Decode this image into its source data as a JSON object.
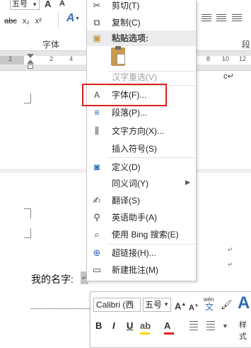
{
  "ribbon": {
    "font_size_value": "五号",
    "grow_font": "A",
    "shrink_font": "A",
    "text_effect": "A",
    "clear_format": "abc",
    "subscript": "x₂",
    "superscript": "x²",
    "group_font_label": "字体",
    "group_paragraph_label": "段"
  },
  "ruler": {
    "ticks": [
      "2",
      "2",
      "4",
      "8",
      "10",
      "12"
    ]
  },
  "context_menu": {
    "items": [
      {
        "label": "剪切(T)",
        "icon": "scissors-icon",
        "enabled": true
      },
      {
        "label": "复制(C)",
        "icon": "copy-icon",
        "enabled": true
      },
      {
        "label": "粘贴选项:",
        "icon": "paste-icon",
        "enabled": true
      },
      {
        "label": "汉字重选(V)",
        "icon": "",
        "enabled": false
      },
      {
        "label": "字体(F)...",
        "icon": "font-icon",
        "enabled": true
      },
      {
        "label": "段落(P)...",
        "icon": "paragraph-icon",
        "enabled": true
      },
      {
        "label": "文字方向(X)...",
        "icon": "text-direction-icon",
        "enabled": true
      },
      {
        "label": "插入符号(S)",
        "icon": "",
        "enabled": true
      },
      {
        "label": "定义(D)",
        "icon": "define-icon",
        "enabled": true
      },
      {
        "label": "同义词(Y)",
        "icon": "",
        "enabled": true,
        "submenu": true
      },
      {
        "label": "翻译(S)",
        "icon": "translate-icon",
        "enabled": true
      },
      {
        "label": "英语助手(A)",
        "icon": "english-assistant-icon",
        "enabled": true
      },
      {
        "label": "使用 Bing 搜索(E)",
        "icon": "search-icon",
        "enabled": true
      },
      {
        "label": "超链接(H)...",
        "icon": "hyperlink-icon",
        "enabled": true
      },
      {
        "label": "新建批注(M)",
        "icon": "new-comment-icon",
        "enabled": true
      }
    ]
  },
  "document": {
    "name_label": "我的名字:",
    "c_mark": "c↵",
    "para_mark": "↵"
  },
  "mini_toolbar": {
    "font_name": "Calibri (西",
    "font_size": "五号",
    "bold": "B",
    "italic": "I",
    "underline": "U",
    "styles_label": "样式",
    "pinyin_label": "wén"
  },
  "colors": {
    "highlight_box": "#e0201b",
    "accent_blue": "#2f6bb5",
    "highlighter_yellow": "#ffd400",
    "font_color_red": "#e0201b"
  }
}
